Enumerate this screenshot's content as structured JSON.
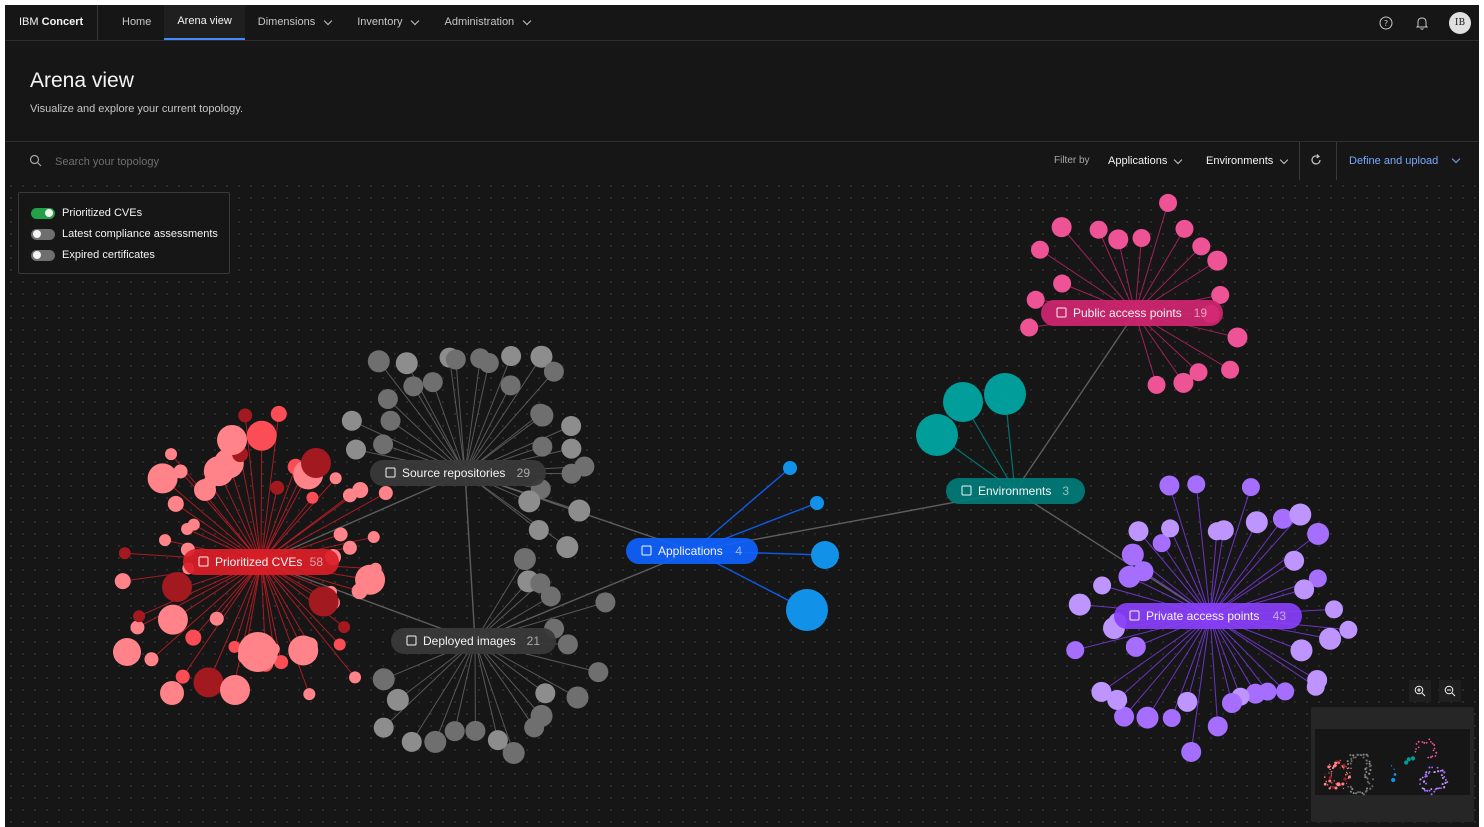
{
  "header": {
    "brand_prefix": "IBM",
    "brand_name": "Concert",
    "nav": [
      {
        "label": "Home"
      },
      {
        "label": "Arena view"
      },
      {
        "label": "Dimensions"
      },
      {
        "label": "Inventory"
      },
      {
        "label": "Administration"
      }
    ],
    "avatar_initials": "IB"
  },
  "page": {
    "title": "Arena view",
    "subtitle": "Visualize and explore your current topology."
  },
  "toolbar": {
    "search_placeholder": "Search your topology",
    "filter_label": "Filter by",
    "filter_applications": "Applications",
    "filter_environments": "Environments",
    "define_upload": "Define and upload"
  },
  "legend": [
    {
      "label": "Prioritized CVEs",
      "enabled": true
    },
    {
      "label": "Latest compliance assessments",
      "enabled": false
    },
    {
      "label": "Expired certificates",
      "enabled": false
    }
  ],
  "nodes": {
    "cves": {
      "label": "Prioritized CVEs",
      "count": "58",
      "icon": "warning-icon",
      "color": "#da1e28"
    },
    "source": {
      "label": "Source repositories",
      "count": "29",
      "icon": "code-icon",
      "color": "#393939"
    },
    "images": {
      "label": "Deployed images",
      "count": "21",
      "icon": "image-stack-icon",
      "color": "#393939"
    },
    "apps": {
      "label": "Applications",
      "count": "4",
      "icon": "application-icon",
      "color": "#0f62fe"
    },
    "envs": {
      "label": "Environments",
      "count": "3",
      "icon": "cloud-icon",
      "color": "#007d79"
    },
    "public": {
      "label": "Public access points",
      "count": "19",
      "icon": "antenna-icon",
      "color": "#d02670"
    },
    "private": {
      "label": "Private access points",
      "count": "43",
      "icon": "building-icon",
      "color": "#8a3ffc"
    }
  },
  "colors": {
    "accent": "#4589ff",
    "cve_leaf": "#ff8389",
    "cve_dark": "#a2191f",
    "gray_leaf": "#6f6f6f",
    "app_leaf": "#1192e8",
    "env_leaf": "#009d9a",
    "public_leaf": "#ee5396",
    "private_leaf": "#a56eff"
  }
}
